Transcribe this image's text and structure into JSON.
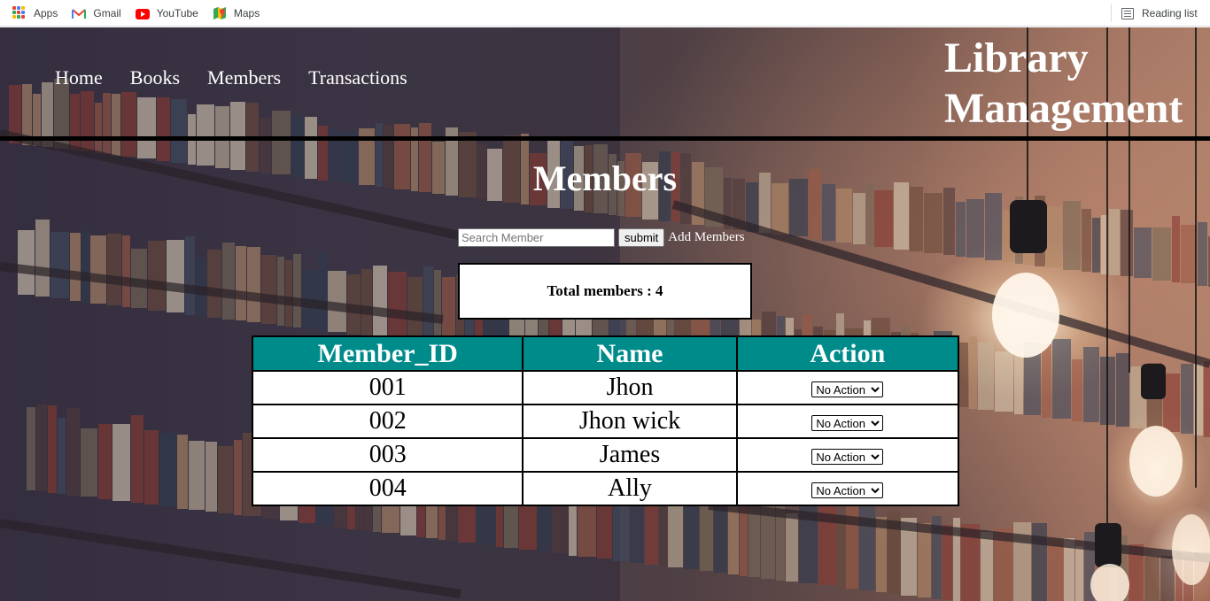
{
  "bookmarks": {
    "items": [
      {
        "label": "Apps",
        "icon": "apps-grid-icon"
      },
      {
        "label": "Gmail",
        "icon": "gmail-icon"
      },
      {
        "label": "YouTube",
        "icon": "youtube-icon"
      },
      {
        "label": "Maps",
        "icon": "maps-icon"
      }
    ],
    "reading_list": {
      "label": "Reading list",
      "icon": "reading-list-icon"
    }
  },
  "header": {
    "nav": [
      {
        "label": "Home"
      },
      {
        "label": "Books"
      },
      {
        "label": "Members"
      },
      {
        "label": "Transactions"
      }
    ],
    "brand_line1": "Library",
    "brand_line2": "Management"
  },
  "main": {
    "title": "Members",
    "search": {
      "placeholder": "Search Member",
      "value": ""
    },
    "submit_label": "submit",
    "add_label": "Add Members",
    "total": "Total members : 4",
    "table": {
      "headers": [
        "Member_ID",
        "Name",
        "Action"
      ],
      "rows": [
        {
          "id": "001",
          "name": "Jhon",
          "action": "No Action"
        },
        {
          "id": "002",
          "name": "Jhon wick",
          "action": "No Action"
        },
        {
          "id": "003",
          "name": "James",
          "action": "No Action"
        },
        {
          "id": "004",
          "name": "Ally",
          "action": "No Action"
        }
      ]
    }
  },
  "colors": {
    "table_header": "#008b8b",
    "text_light": "#ffffff"
  }
}
